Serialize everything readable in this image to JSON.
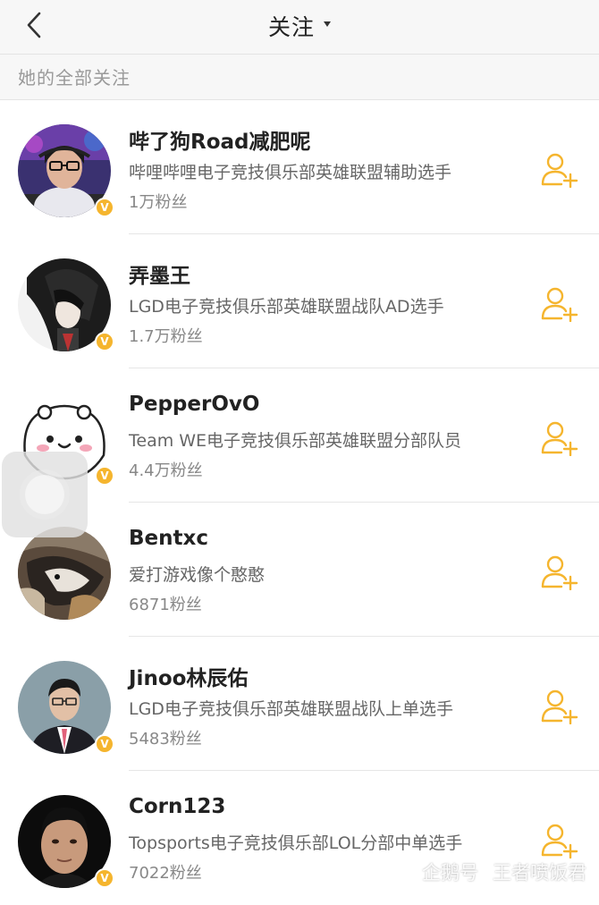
{
  "nav": {
    "title": "关注",
    "back_icon": "chevron-left-icon",
    "dropdown_icon": "caret-down-icon"
  },
  "section": {
    "label": "她的全部关注"
  },
  "colors": {
    "accent": "#f5b52e",
    "background": "#ffffff",
    "header_bg": "#f7f7f7"
  },
  "follows": [
    {
      "name": "哔了狗Road减肥呢",
      "desc": "哔哩哔哩电子竞技俱乐部英雄联盟辅助选手",
      "fans": "1万粉丝",
      "verified": true
    },
    {
      "name": "弄墨王",
      "desc": "LGD电子竞技俱乐部英雄联盟战队AD选手",
      "fans": "1.7万粉丝",
      "verified": true
    },
    {
      "name": "PepperOvO",
      "desc": "Team WE电子竞技俱乐部英雄联盟分部队员",
      "fans": "4.4万粉丝",
      "verified": true
    },
    {
      "name": "Bentxc",
      "desc": "爱打游戏像个憨憨",
      "fans": "6871粉丝",
      "verified": false
    },
    {
      "name": "Jinoo林辰佑",
      "desc": "LGD电子竞技俱乐部英雄联盟战队上单选手",
      "fans": "5483粉丝",
      "verified": true
    },
    {
      "name": "Corn123",
      "desc": "Topsports电子竞技俱乐部LOL分部中单选手",
      "fans": "7022粉丝",
      "verified": true
    }
  ],
  "verified_badge": "V",
  "follow_icon": "add-user-icon",
  "watermark": {
    "platform": "企鹅号",
    "author": "王者喷饭君"
  }
}
